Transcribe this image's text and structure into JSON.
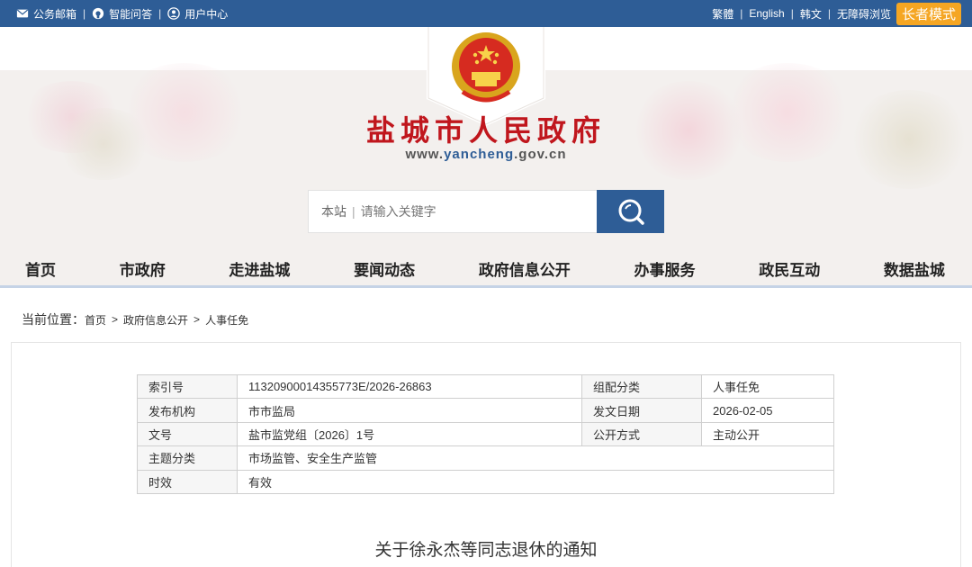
{
  "topbar": {
    "left_items": [
      {
        "label": "公务邮箱",
        "icon": "mail-icon"
      },
      {
        "label": "智能问答",
        "icon": "chat-robot-icon"
      },
      {
        "label": "用户中心",
        "icon": "user-icon"
      }
    ],
    "right_items": [
      "繁體",
      "English",
      "韩文",
      "无障碍浏览"
    ],
    "elder_mode": "长者模式"
  },
  "header": {
    "site_title": "盐城市人民政府",
    "domain_prefix": "www.",
    "domain_main": "yancheng",
    "domain_suffix": ".gov.cn",
    "emblem": "national-emblem-icon"
  },
  "search": {
    "scope": "本站",
    "divider": "|",
    "placeholder": "请输入关键字",
    "button_icon": "search-icon"
  },
  "nav": {
    "items": [
      "首页",
      "市政府",
      "走进盐城",
      "要闻动态",
      "政府信息公开",
      "办事服务",
      "政民互动",
      "数据盐城"
    ]
  },
  "breadcrumb": {
    "label": "当前位置：",
    "items": [
      "首页",
      "政府信息公开",
      "人事任免"
    ],
    "separator": ">"
  },
  "meta_table": {
    "index_no_label": "索引号",
    "index_no": "11320900014355773E/2026-26863",
    "category_label": "组配分类",
    "category": "人事任免",
    "publisher_label": "发布机构",
    "publisher": "市市监局",
    "date_label": "发文日期",
    "date": "2026-02-05",
    "doc_no_label": "文号",
    "doc_no": "盐市监党组〔2026〕1号",
    "open_mode_label": "公开方式",
    "open_mode": "主动公开",
    "topic_label": "主题分类",
    "topic": "市场监管、安全生产监管",
    "validity_label": "时效",
    "validity": "有效"
  },
  "document": {
    "title": "关于徐永杰等同志退休的通知"
  },
  "colors": {
    "primary_blue": "#2e5d96",
    "title_red": "#c0161d",
    "elder_orange": "#f5a623",
    "banner_bg": "#f3f0ee"
  }
}
